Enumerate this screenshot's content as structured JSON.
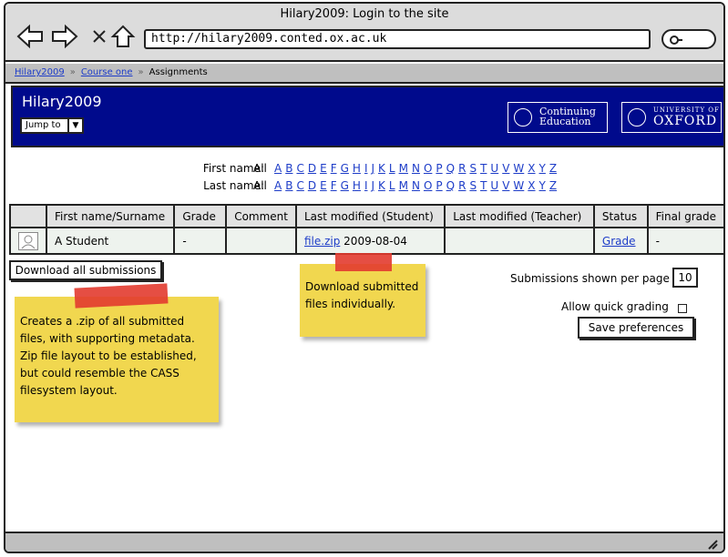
{
  "window": {
    "title": "Hilary2009: Login to the site"
  },
  "browser": {
    "url": "http://hilary2009.conted.ox.ac.uk"
  },
  "breadcrumb": {
    "items": [
      "Hilary2009",
      "Course one",
      "Assignments"
    ]
  },
  "header": {
    "site_title": "Hilary2009",
    "jump_label": "Jump to",
    "logo_ce_line1": "Continuing",
    "logo_ce_line2": "Education",
    "logo_ox_line1": "UNIVERSITY OF",
    "logo_ox_line2": "OXFORD"
  },
  "filters": {
    "first_label": "First name:",
    "last_label": "Last name:",
    "all": "All",
    "letters": [
      "A",
      "B",
      "C",
      "D",
      "E",
      "F",
      "G",
      "H",
      "I",
      "J",
      "K",
      "L",
      "M",
      "N",
      "O",
      "P",
      "Q",
      "R",
      "S",
      "T",
      "U",
      "V",
      "W",
      "X",
      "Y",
      "Z"
    ]
  },
  "table": {
    "headers": [
      "",
      "First name/Surname",
      "Grade",
      "Comment",
      "Last modified (Student)",
      "Last modified (Teacher)",
      "Status",
      "Final grade"
    ],
    "row": {
      "name": "A Student",
      "grade": "-",
      "comment": "",
      "file": "file.zip",
      "student_modified": "2009-08-04",
      "teacher_modified": "",
      "status": "Grade",
      "final_grade": "-"
    }
  },
  "actions": {
    "download_all": "Download all submissions",
    "per_page_label": "Submissions shown per page",
    "per_page_value": "10",
    "quick_grading_label": "Allow quick grading",
    "save_prefs": "Save preferences"
  },
  "notes": {
    "zip": "Creates a .zip of all submitted files, with supporting metadata. Zip file layout to be established, but could resemble the CASS filesystem layout.",
    "individual": "Download submitted files individually."
  },
  "colors": {
    "header_bg": "#000a8c",
    "link": "#1d3cc8",
    "note": "#f1d74f",
    "tape": "#e23b2f"
  }
}
